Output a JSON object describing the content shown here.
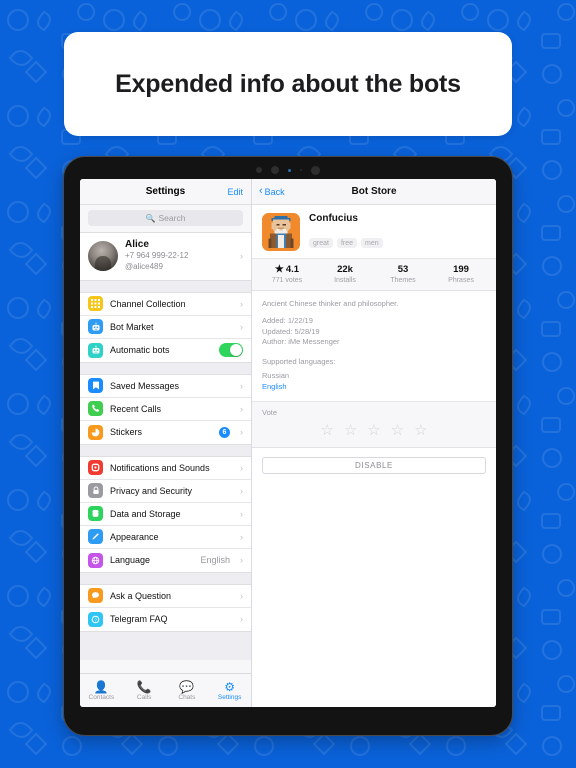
{
  "headline": {
    "text": "Expended info about the bots"
  },
  "theme": {
    "background": "#0a62da",
    "accent": "#1a8cff",
    "toggle_on": "#2fd65e"
  },
  "sidebar": {
    "title": "Settings",
    "edit_label": "Edit",
    "search": {
      "placeholder": "Search",
      "icon": "search-icon"
    },
    "profile": {
      "name": "Alice",
      "phone": "+7 964 999-22-12",
      "username": "@alice489"
    },
    "group_bots": [
      {
        "label": "Channel Collection",
        "icon": "grid-icon",
        "color": "#f5c518",
        "type": "chevron"
      },
      {
        "label": "Bot Market",
        "icon": "robot-icon",
        "color": "#2f9cf4",
        "type": "chevron"
      },
      {
        "label": "Automatic bots",
        "icon": "robot-icon",
        "color": "#2fd2c8",
        "type": "toggle",
        "toggle_on": true
      }
    ],
    "group_messages": [
      {
        "label": "Saved Messages",
        "icon": "bookmark-icon",
        "color": "#1a8cff",
        "type": "chevron"
      },
      {
        "label": "Recent Calls",
        "icon": "phone-icon",
        "color": "#3fce4e",
        "type": "chevron"
      },
      {
        "label": "Stickers",
        "icon": "sticker-icon",
        "color": "#f79a1e",
        "type": "badge",
        "badge": "6"
      }
    ],
    "group_settings": [
      {
        "label": "Notifications and Sounds",
        "icon": "bell-icon",
        "color": "#f23b30",
        "type": "chevron"
      },
      {
        "label": "Privacy and Security",
        "icon": "lock-icon",
        "color": "#9a9aa0",
        "type": "chevron"
      },
      {
        "label": "Data and Storage",
        "icon": "database-icon",
        "color": "#2ed35e",
        "type": "chevron"
      },
      {
        "label": "Appearance",
        "icon": "pencil-icon",
        "color": "#2f9cf4",
        "type": "chevron"
      },
      {
        "label": "Language",
        "icon": "globe-icon",
        "color": "#c455e8",
        "type": "value",
        "value": "English"
      }
    ],
    "group_help": [
      {
        "label": "Ask a Question",
        "icon": "chat-bubble-icon",
        "color": "#f79a1e",
        "type": "chevron"
      },
      {
        "label": "Telegram FAQ",
        "icon": "question-icon",
        "color": "#2fc5f4",
        "type": "chevron"
      }
    ],
    "tabs": [
      {
        "label": "Contacts",
        "icon": "person-icon",
        "active": false
      },
      {
        "label": "Calls",
        "icon": "phone-icon",
        "active": false
      },
      {
        "label": "Chats",
        "icon": "chats-icon",
        "active": false
      },
      {
        "label": "Settings",
        "icon": "gear-icon",
        "active": true
      }
    ]
  },
  "detail": {
    "back_label": "Back",
    "title": "Bot Store",
    "bot": {
      "name": "Confucius",
      "avatar_color": "#f08a2c",
      "tags": [
        "great",
        "free",
        "men"
      ],
      "stats": [
        {
          "value": "4.1",
          "sub": "771 votes",
          "has_star": true
        },
        {
          "value": "22k",
          "sub": "Installs",
          "has_star": false
        },
        {
          "value": "53",
          "sub": "Themes",
          "has_star": false
        },
        {
          "value": "199",
          "sub": "Phrases",
          "has_star": false
        }
      ],
      "description": "Ancient Chinese thinker and philosopher.",
      "meta": [
        "Added: 1/22/19",
        "Updated: 5/28/19",
        "Author: iMe Messenger"
      ],
      "languages_title": "Supported languages:",
      "languages": [
        {
          "name": "Russian",
          "selected": false
        },
        {
          "name": "English",
          "selected": true
        }
      ]
    },
    "vote": {
      "label": "Vote",
      "stars": 5,
      "filled": 0
    },
    "disable_label": "DISABLE"
  }
}
